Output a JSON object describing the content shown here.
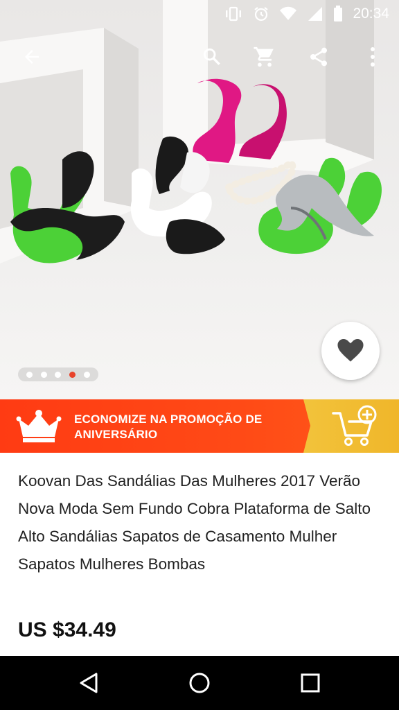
{
  "status_bar": {
    "time": "20:34"
  },
  "product": {
    "title": "Koovan Das Sandálias Das Mulheres 2017 Verão Nova Moda Sem Fundo Cobra Plataforma de Salto Alto Sandálias Sapatos de Casamento Mulher Sapatos Mulheres Bombas",
    "price": "US $34.49"
  },
  "gallery": {
    "count": 5,
    "active_index": 3
  },
  "promo": {
    "text": "ECONOMIZE NA PROMOÇÃO DE ANIVERSÁRIO"
  },
  "colors": {
    "accent": "#e8422a",
    "promo_red": "#ff4316",
    "promo_gold": "#f0b62a",
    "shoe_green": "#4cd137",
    "shoe_pink": "#e01884"
  },
  "icons": [
    "back-arrow-icon",
    "search-icon",
    "cart-icon",
    "share-icon",
    "more-vert-icon",
    "heart-icon",
    "crown-icon",
    "add-to-cart-icon",
    "nav-back-icon",
    "nav-home-icon",
    "nav-recents-icon"
  ]
}
